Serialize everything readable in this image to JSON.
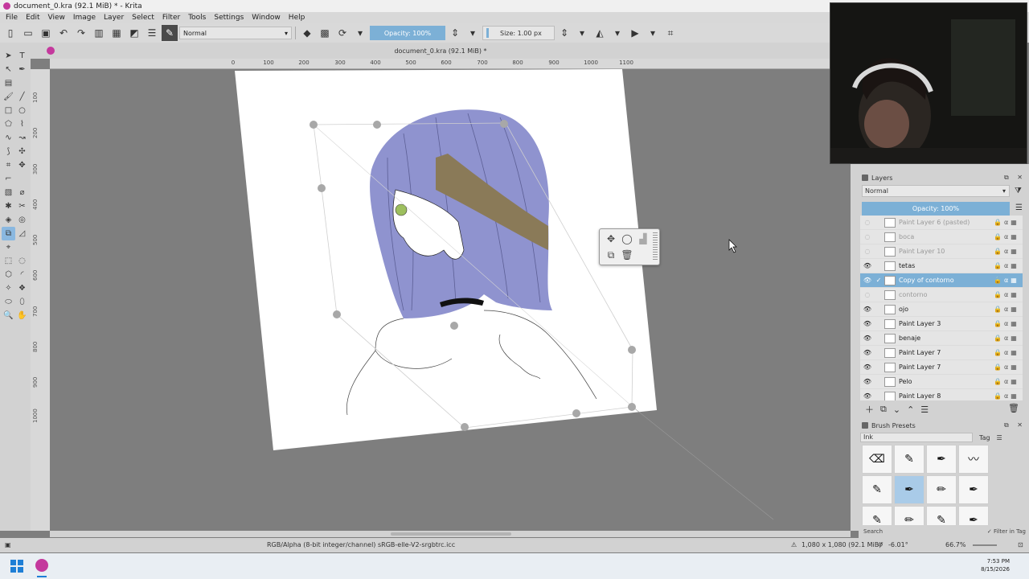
{
  "window": {
    "title": "document_0.kra (92.1 MiB) * - Krita"
  },
  "menu": [
    "File",
    "Edit",
    "View",
    "Image",
    "Layer",
    "Select",
    "Filter",
    "Tools",
    "Settings",
    "Window",
    "Help"
  ],
  "toolbar": {
    "blend_mode": "Normal",
    "opacity": "Opacity: 100%",
    "size": "Size: 1.00 px"
  },
  "canvas": {
    "tab_title": "document_0.kra (92.1 MiB) *",
    "ruler_top": [
      "0",
      "100",
      "200",
      "300",
      "400",
      "500",
      "600",
      "700",
      "800",
      "900",
      "1000",
      "1100"
    ],
    "ruler_left": [
      "100",
      "200",
      "300",
      "400",
      "500",
      "600",
      "700",
      "800",
      "900",
      "1000"
    ]
  },
  "layers_docker": {
    "title": "Layers",
    "blend_mode": "Normal",
    "opacity": "Opacity: 100%",
    "layers": [
      {
        "name": "Paint Layer 6 (pasted)",
        "visible": false,
        "selected": false
      },
      {
        "name": "boca",
        "visible": false,
        "selected": false
      },
      {
        "name": "Paint Layer 10",
        "visible": false,
        "selected": false
      },
      {
        "name": "tetas",
        "visible": true,
        "selected": false
      },
      {
        "name": "Copy of contorno",
        "visible": true,
        "selected": true
      },
      {
        "name": "contorno",
        "visible": false,
        "selected": false
      },
      {
        "name": "ojo",
        "visible": true,
        "selected": false
      },
      {
        "name": "Paint Layer 3",
        "visible": true,
        "selected": false
      },
      {
        "name": "benaje",
        "visible": true,
        "selected": false
      },
      {
        "name": "Paint Layer 7",
        "visible": true,
        "selected": false
      },
      {
        "name": "Paint Layer 7",
        "visible": true,
        "selected": false
      },
      {
        "name": "Pelo",
        "visible": true,
        "selected": false
      },
      {
        "name": "Paint Layer 8",
        "visible": true,
        "selected": false
      }
    ]
  },
  "brush_presets": {
    "title": "Brush Presets",
    "tag": "Ink",
    "tag_button": "Tag",
    "search_label": "Search",
    "filter_in_tag": "Filter in Tag"
  },
  "status": {
    "color_profile": "RGB/Alpha (8-bit integer/channel)  sRGB-elle-V2-srgbtrc.icc",
    "image_size": "1,080 x 1,080 (92.1 MiB)",
    "rotation": "-6.01°",
    "zoom": "66.7%"
  },
  "taskbar": {
    "time": "7:53 PM",
    "date": "8/15/2026"
  },
  "colors": {
    "accent": "#7cb0d6",
    "hair": "#8f93cf",
    "bandage": "#8a7a58",
    "eye": "#9dbf5e"
  }
}
